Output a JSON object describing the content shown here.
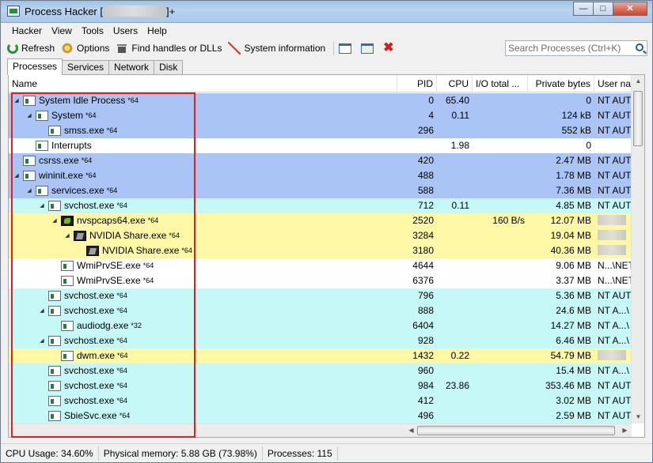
{
  "window": {
    "title_prefix": "Process Hacker [",
    "title_suffix": "]+",
    "controls": {
      "minimize": "—",
      "maximize": "□",
      "close": "✕"
    }
  },
  "menu": [
    "Hacker",
    "View",
    "Tools",
    "Users",
    "Help"
  ],
  "toolbar": {
    "refresh": "Refresh",
    "options": "Options",
    "find_handles": "Find handles or DLLs",
    "system_information": "System information",
    "icons": [
      "refresh-icon",
      "options-icon",
      "find-handles-icon",
      "system-information-icon",
      "window-icon",
      "window-find-icon",
      "terminate-icon"
    ]
  },
  "search": {
    "placeholder": "Search Processes (Ctrl+K)"
  },
  "tabs": [
    "Processes",
    "Services",
    "Network",
    "Disk"
  ],
  "columns": [
    "Name",
    "PID",
    "CPU",
    "I/O total ...",
    "Private bytes",
    "User na"
  ],
  "processes": [
    {
      "name": "System Idle Process",
      "tag": "*64",
      "depth": 0,
      "expand": "◢",
      "pid": "0",
      "cpu": "65.40",
      "io": "",
      "private": "0",
      "user": "NT AUT",
      "color": "blue",
      "icon": "window"
    },
    {
      "name": "System",
      "tag": "*64",
      "depth": 1,
      "expand": "◢",
      "pid": "4",
      "cpu": "0.11",
      "io": "",
      "private": "124 kB",
      "user": "NT AUT",
      "color": "blue",
      "icon": "window"
    },
    {
      "name": "smss.exe",
      "tag": "*64",
      "depth": 2,
      "expand": "",
      "pid": "296",
      "cpu": "",
      "io": "",
      "private": "552 kB",
      "user": "NT AUT",
      "color": "blue",
      "icon": "window"
    },
    {
      "name": "Interrupts",
      "tag": "",
      "depth": 1,
      "expand": "",
      "pid": "",
      "cpu": "1.98",
      "io": "",
      "private": "0",
      "user": "",
      "color": "white",
      "icon": "window"
    },
    {
      "name": "csrss.exe",
      "tag": "*64",
      "depth": 0,
      "expand": "",
      "pid": "420",
      "cpu": "",
      "io": "",
      "private": "2.47 MB",
      "user": "NT AUT",
      "color": "blue",
      "icon": "window"
    },
    {
      "name": "wininit.exe",
      "tag": "*64",
      "depth": 0,
      "expand": "◢",
      "pid": "488",
      "cpu": "",
      "io": "",
      "private": "1.78 MB",
      "user": "NT AUT",
      "color": "blue",
      "icon": "window"
    },
    {
      "name": "services.exe",
      "tag": "*64",
      "depth": 1,
      "expand": "◢",
      "pid": "588",
      "cpu": "",
      "io": "",
      "private": "7.36 MB",
      "user": "NT AUT",
      "color": "blue",
      "icon": "window"
    },
    {
      "name": "svchost.exe",
      "tag": "*64",
      "depth": 2,
      "expand": "◢",
      "pid": "712",
      "cpu": "0.11",
      "io": "",
      "private": "4.85 MB",
      "user": "NT AUT",
      "color": "cyan",
      "icon": "window"
    },
    {
      "name": "nvspcaps64.exe",
      "tag": "*64",
      "depth": 3,
      "expand": "◢",
      "pid": "2520",
      "cpu": "",
      "io": "160 B/s",
      "private": "12.07 MB",
      "user": "",
      "color": "yellow",
      "icon": "nvidia"
    },
    {
      "name": "NVIDIA Share.exe",
      "tag": "*64",
      "depth": 4,
      "expand": "◢",
      "pid": "3284",
      "cpu": "",
      "io": "",
      "private": "19.04 MB",
      "user": "",
      "color": "yellow",
      "icon": "nvshare"
    },
    {
      "name": "NVIDIA Share.exe",
      "tag": "*64",
      "depth": 5,
      "expand": "",
      "pid": "3180",
      "cpu": "",
      "io": "",
      "private": "40.36 MB",
      "user": "",
      "color": "yellow",
      "icon": "nvshare"
    },
    {
      "name": "WmiPrvSE.exe",
      "tag": "*64",
      "depth": 3,
      "expand": "",
      "pid": "4644",
      "cpu": "",
      "io": "",
      "private": "9.06 MB",
      "user": "N...\\NET",
      "color": "white",
      "icon": "window"
    },
    {
      "name": "WmiPrvSE.exe",
      "tag": "*64",
      "depth": 3,
      "expand": "",
      "pid": "6376",
      "cpu": "",
      "io": "",
      "private": "3.37 MB",
      "user": "N...\\NET",
      "color": "white",
      "icon": "window"
    },
    {
      "name": "svchost.exe",
      "tag": "*64",
      "depth": 2,
      "expand": "",
      "pid": "796",
      "cpu": "",
      "io": "",
      "private": "5.36 MB",
      "user": "NT AUT",
      "color": "cyan",
      "icon": "window"
    },
    {
      "name": "svchost.exe",
      "tag": "*64",
      "depth": 2,
      "expand": "◢",
      "pid": "888",
      "cpu": "",
      "io": "",
      "private": "24.6 MB",
      "user": "NT A...\\",
      "color": "cyan",
      "icon": "window"
    },
    {
      "name": "audiodg.exe",
      "tag": "*32",
      "depth": 3,
      "expand": "",
      "pid": "6404",
      "cpu": "",
      "io": "",
      "private": "14.27 MB",
      "user": "NT A...\\",
      "color": "cyan",
      "icon": "window"
    },
    {
      "name": "svchost.exe",
      "tag": "*64",
      "depth": 2,
      "expand": "◢",
      "pid": "928",
      "cpu": "",
      "io": "",
      "private": "6.46 MB",
      "user": "NT A...\\",
      "color": "cyan",
      "icon": "window"
    },
    {
      "name": "dwm.exe",
      "tag": "*64",
      "depth": 3,
      "expand": "",
      "pid": "1432",
      "cpu": "0.22",
      "io": "",
      "private": "54.79 MB",
      "user": "",
      "color": "yellow",
      "icon": "window"
    },
    {
      "name": "svchost.exe",
      "tag": "*64",
      "depth": 2,
      "expand": "",
      "pid": "960",
      "cpu": "",
      "io": "",
      "private": "15.4 MB",
      "user": "NT A...\\",
      "color": "cyan",
      "icon": "window"
    },
    {
      "name": "svchost.exe",
      "tag": "*64",
      "depth": 2,
      "expand": "",
      "pid": "984",
      "cpu": "23.86",
      "io": "",
      "private": "353.46 MB",
      "user": "NT AUT",
      "color": "cyan",
      "icon": "window"
    },
    {
      "name": "svchost.exe",
      "tag": "*64",
      "depth": 2,
      "expand": "",
      "pid": "412",
      "cpu": "",
      "io": "",
      "private": "3.02 MB",
      "user": "NT AUT",
      "color": "cyan",
      "icon": "window"
    },
    {
      "name": "SbieSvc.exe",
      "tag": "*64",
      "depth": 2,
      "expand": "",
      "pid": "496",
      "cpu": "",
      "io": "",
      "private": "2.59 MB",
      "user": "NT AUT",
      "color": "cyan",
      "icon": "window"
    },
    {
      "name": "svchost.exe",
      "tag": "*64",
      "depth": 2,
      "expand": "",
      "pid": "",
      "cpu": "",
      "io": "",
      "private": "",
      "user": "",
      "color": "cyan",
      "icon": "window"
    }
  ],
  "statusbar": {
    "cpu": "CPU Usage: 34.60%",
    "memory": "Physical memory: 5.88 GB (73.98%)",
    "processes": "Processes: 115"
  },
  "colors": {
    "own_process": "#a9c4f5",
    "service": "#c6f8f8",
    "gui_highlight": "#fdf7a6",
    "annotation_box": "#e0211b"
  }
}
